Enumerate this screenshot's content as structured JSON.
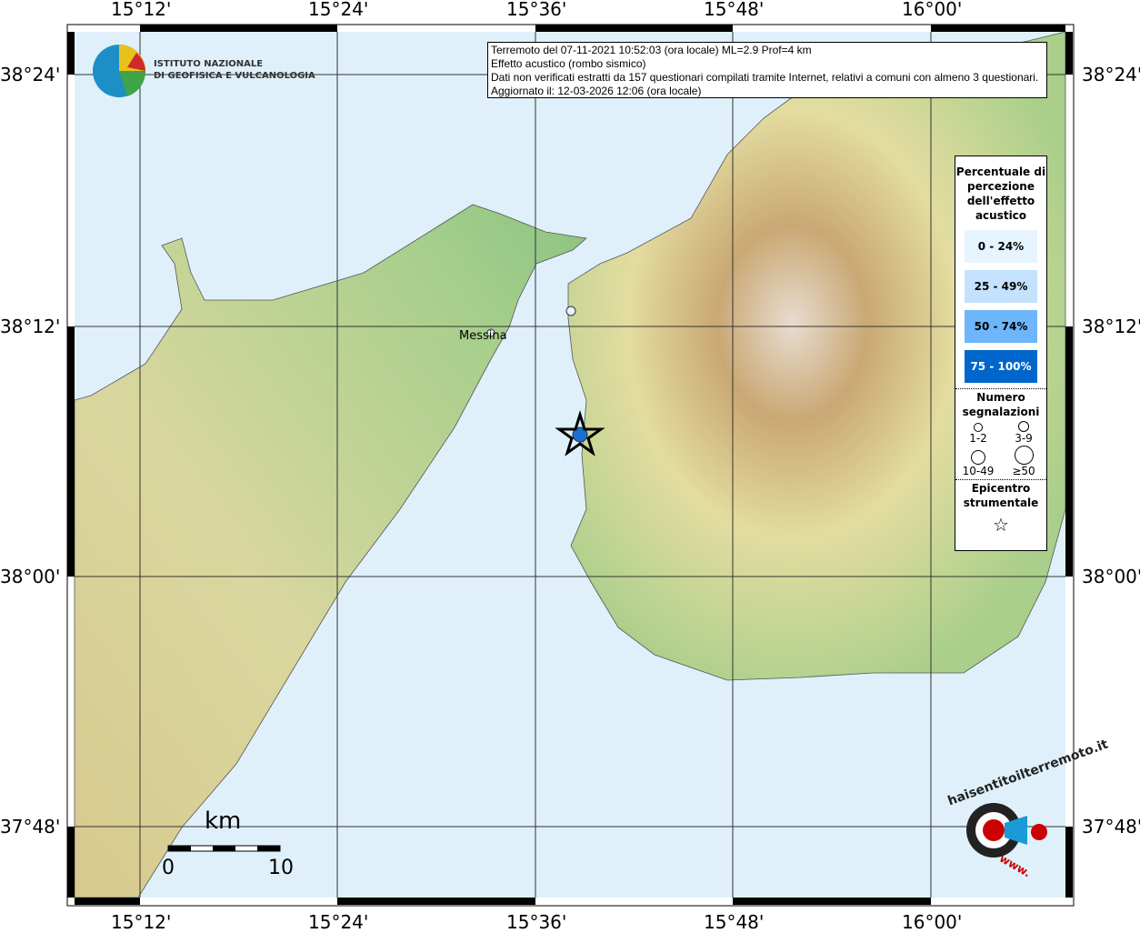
{
  "info_box": {
    "line1": "Terremoto del 07-11-2021 10:52:03 (ora locale) ML=2.9 Prof=4 km",
    "line2": "Effetto acustico (rombo sismico)",
    "line3": "Dati non verificati estratti da 157 questionari compilati tramite Internet, relativi a comuni con almeno 3 questionari.",
    "line4": "Aggiornato il: 12-03-2026 12:06 (ora locale)"
  },
  "logo": {
    "line1": "ISTITUTO NAZIONALE",
    "line2": "DI GEOFISICA E VULCANOLOGIA"
  },
  "axes": {
    "lon_ticks": [
      "15°12'",
      "15°24'",
      "15°36'",
      "15°48'",
      "16°00'"
    ],
    "lat_ticks": [
      "38°24'",
      "38°12'",
      "38°00'",
      "37°48'"
    ]
  },
  "places": {
    "messina": "Messina"
  },
  "scale": {
    "unit": "km",
    "start": "0",
    "end": "10"
  },
  "legend": {
    "title": "Percentuale di percezione dell'effetto acustico",
    "classes": [
      {
        "label": "0 - 24%",
        "color": "#e6f4ff"
      },
      {
        "label": "25 - 49%",
        "color": "#c4e2fd"
      },
      {
        "label": "50 - 74%",
        "color": "#6eb6fb"
      },
      {
        "label": "75 - 100%",
        "color": "#0066cc"
      }
    ],
    "count_title": "Numero segnalazioni",
    "counts": [
      "1-2",
      "3-9",
      "10-49",
      "≥50"
    ],
    "epicenter_title": "Epicentro strumentale"
  },
  "hst_logo": {
    "text": "haisentitoilterremoto.it",
    "url_text": "www."
  },
  "colors": {
    "sea": "#dff0fb",
    "epicenter": "#1a6fd0"
  }
}
